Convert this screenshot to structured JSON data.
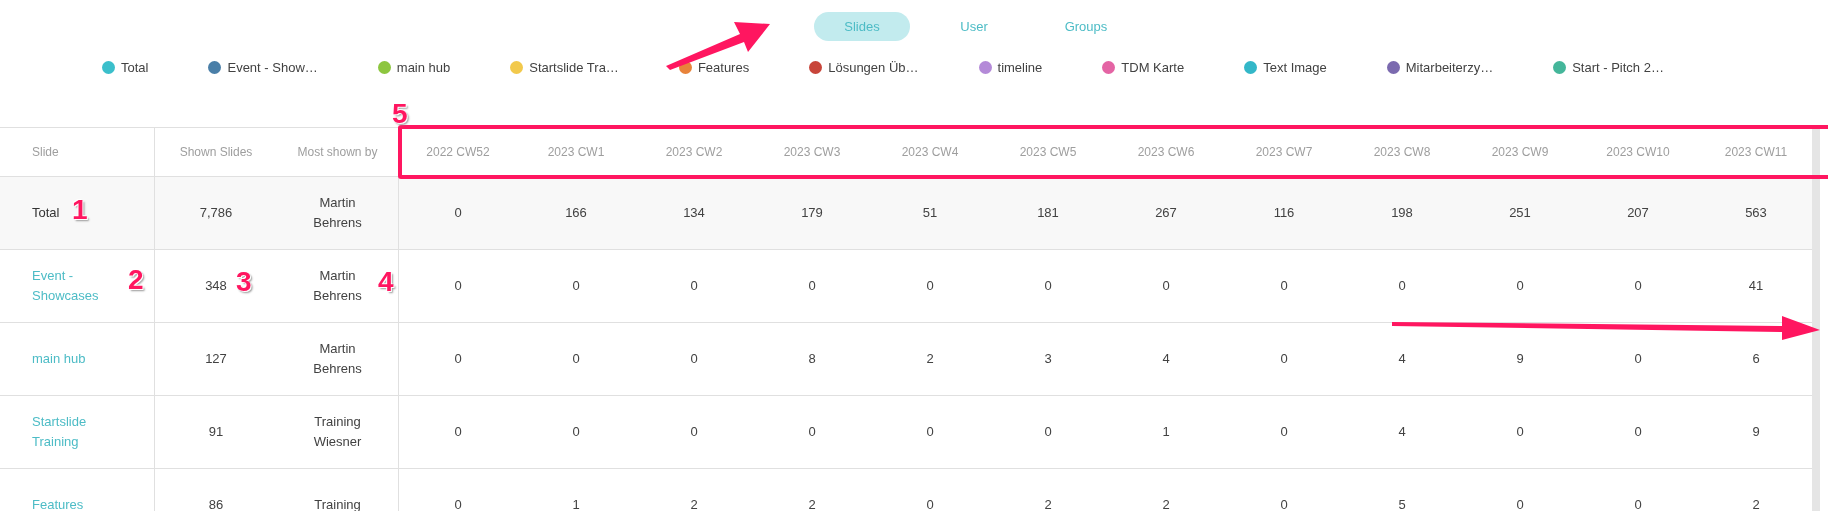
{
  "tabs": [
    {
      "label": "Slides",
      "selected": true
    },
    {
      "label": "User",
      "selected": false
    },
    {
      "label": "Groups",
      "selected": false
    }
  ],
  "legend": [
    {
      "label": "Total",
      "color": "#3bbfcb"
    },
    {
      "label": "Event - Show…",
      "color": "#4a7fa8"
    },
    {
      "label": "main hub",
      "color": "#8dc63f"
    },
    {
      "label": "Startslide Tra…",
      "color": "#f2c94c"
    },
    {
      "label": "Features",
      "color": "#e8833a"
    },
    {
      "label": "Lösungen Üb…",
      "color": "#c8453a"
    },
    {
      "label": "timeline",
      "color": "#b48ad8"
    },
    {
      "label": "TDM Karte",
      "color": "#e464a4"
    },
    {
      "label": "Text Image",
      "color": "#33b7c8"
    },
    {
      "label": "Mitarbeiterzy…",
      "color": "#7b6aaf"
    },
    {
      "label": "Start - Pitch 2…",
      "color": "#44b69a"
    }
  ],
  "table": {
    "columns": [
      "Slide",
      "Shown Slides",
      "Most shown by",
      "2022 CW52",
      "2023 CW1",
      "2023 CW2",
      "2023 CW3",
      "2023 CW4",
      "2023 CW5",
      "2023 CW6",
      "2023 CW7",
      "2023 CW8",
      "2023 CW9",
      "2023 CW10",
      "2023 CW11"
    ],
    "rows": [
      {
        "kind": "total",
        "slide": "Total",
        "shown": "7,786",
        "by": "Martin Behrens",
        "weeks": [
          "0",
          "166",
          "134",
          "179",
          "51",
          "181",
          "267",
          "116",
          "198",
          "251",
          "207",
          "563"
        ]
      },
      {
        "kind": "slide",
        "slide": "Event - Showcases",
        "shown": "348",
        "by": "Martin Behrens",
        "weeks": [
          "0",
          "0",
          "0",
          "0",
          "0",
          "0",
          "0",
          "0",
          "0",
          "0",
          "0",
          "41"
        ]
      },
      {
        "kind": "slide",
        "slide": "main hub",
        "shown": "127",
        "by": "Martin Behrens",
        "weeks": [
          "0",
          "0",
          "0",
          "8",
          "2",
          "3",
          "4",
          "0",
          "4",
          "9",
          "0",
          "6"
        ]
      },
      {
        "kind": "slide",
        "slide": "Startslide Training",
        "shown": "91",
        "by": "Training Wiesner",
        "weeks": [
          "0",
          "0",
          "0",
          "0",
          "0",
          "0",
          "1",
          "0",
          "4",
          "0",
          "0",
          "9"
        ]
      },
      {
        "kind": "slide",
        "slide": "Features",
        "shown": "86",
        "by": "Training",
        "weeks": [
          "0",
          "1",
          "2",
          "2",
          "0",
          "2",
          "2",
          "0",
          "5",
          "0",
          "0",
          "2"
        ]
      }
    ]
  },
  "annotations": [
    "1",
    "2",
    "3",
    "4",
    "5"
  ]
}
